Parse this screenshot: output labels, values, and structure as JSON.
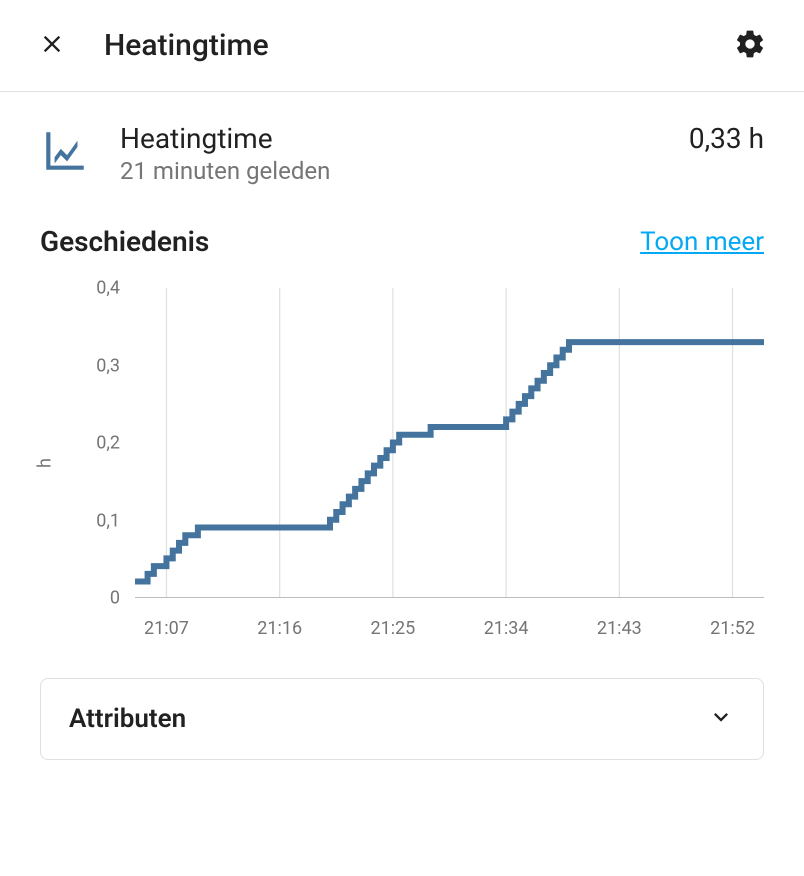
{
  "header": {
    "title": "Heatingtime"
  },
  "entity": {
    "name": "Heatingtime",
    "subtext": "21 minuten geleden",
    "value": "0,33 h"
  },
  "history": {
    "section_title": "Geschiedenis",
    "show_more": "Toon meer",
    "y_axis_label": "h"
  },
  "attributes": {
    "label": "Attributen"
  },
  "chart_data": {
    "type": "line",
    "title": "",
    "xlabel": "",
    "ylabel": "h",
    "ylim": [
      0,
      0.4
    ],
    "x_ticks": [
      "21:07",
      "21:16",
      "21:25",
      "21:34",
      "21:43",
      "21:52"
    ],
    "y_ticks": [
      0,
      0.1,
      0.2,
      0.3,
      0.4
    ],
    "y_tick_labels": [
      "0",
      "0,1",
      "0,2",
      "0,3",
      "0,4"
    ],
    "series": [
      {
        "name": "Heatingtime",
        "color": "#44739e",
        "points": [
          {
            "x": 0.0,
            "y": 0.02
          },
          {
            "x": 0.02,
            "y": 0.03
          },
          {
            "x": 0.03,
            "y": 0.04
          },
          {
            "x": 0.05,
            "y": 0.05
          },
          {
            "x": 0.06,
            "y": 0.06
          },
          {
            "x": 0.07,
            "y": 0.07
          },
          {
            "x": 0.08,
            "y": 0.08
          },
          {
            "x": 0.1,
            "y": 0.09
          },
          {
            "x": 0.3,
            "y": 0.09
          },
          {
            "x": 0.31,
            "y": 0.1
          },
          {
            "x": 0.32,
            "y": 0.11
          },
          {
            "x": 0.33,
            "y": 0.12
          },
          {
            "x": 0.34,
            "y": 0.13
          },
          {
            "x": 0.35,
            "y": 0.14
          },
          {
            "x": 0.36,
            "y": 0.15
          },
          {
            "x": 0.37,
            "y": 0.16
          },
          {
            "x": 0.38,
            "y": 0.17
          },
          {
            "x": 0.39,
            "y": 0.18
          },
          {
            "x": 0.4,
            "y": 0.19
          },
          {
            "x": 0.41,
            "y": 0.2
          },
          {
            "x": 0.42,
            "y": 0.21
          },
          {
            "x": 0.46,
            "y": 0.21
          },
          {
            "x": 0.47,
            "y": 0.22
          },
          {
            "x": 0.58,
            "y": 0.22
          },
          {
            "x": 0.59,
            "y": 0.23
          },
          {
            "x": 0.6,
            "y": 0.24
          },
          {
            "x": 0.61,
            "y": 0.25
          },
          {
            "x": 0.62,
            "y": 0.26
          },
          {
            "x": 0.63,
            "y": 0.27
          },
          {
            "x": 0.64,
            "y": 0.28
          },
          {
            "x": 0.65,
            "y": 0.29
          },
          {
            "x": 0.66,
            "y": 0.3
          },
          {
            "x": 0.67,
            "y": 0.31
          },
          {
            "x": 0.68,
            "y": 0.32
          },
          {
            "x": 0.69,
            "y": 0.33
          },
          {
            "x": 1.0,
            "y": 0.33
          }
        ]
      }
    ]
  }
}
